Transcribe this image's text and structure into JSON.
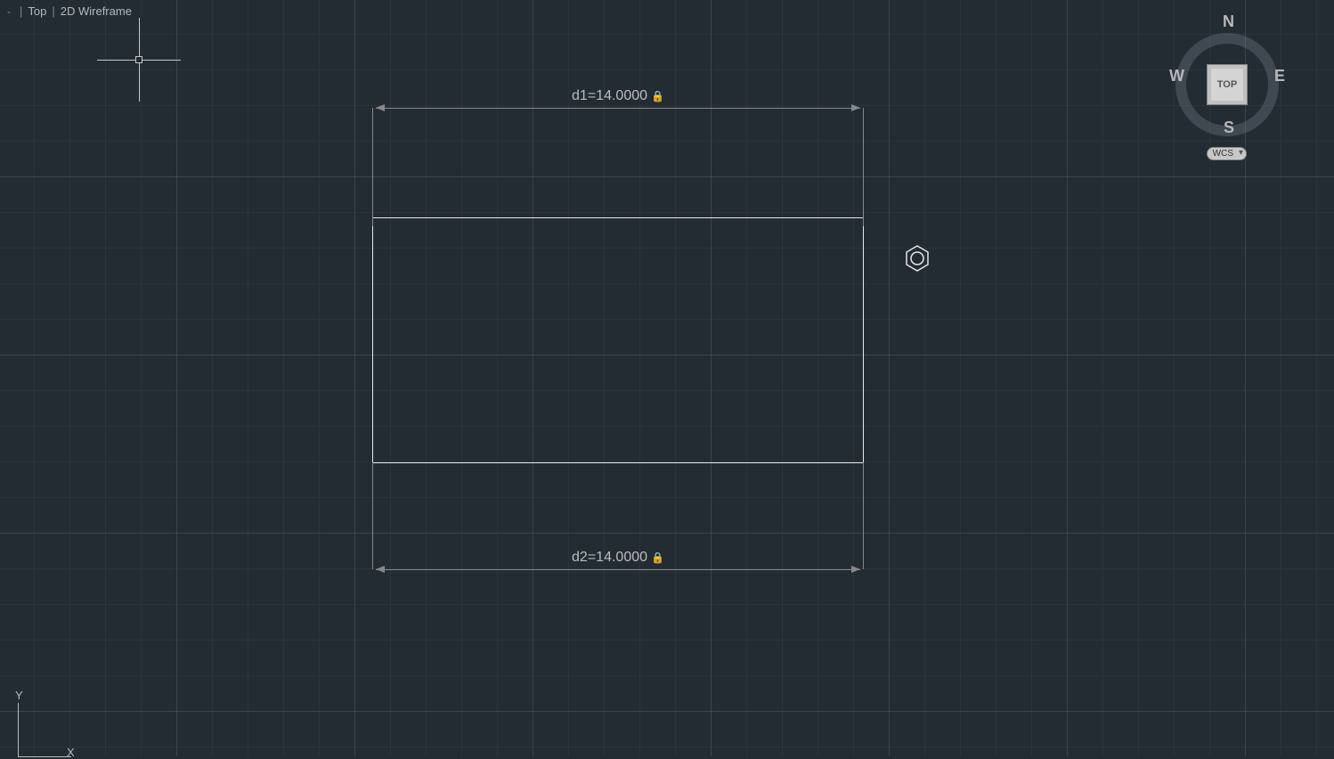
{
  "view_controls": {
    "minimize": "-",
    "orientation": "Top",
    "visual_style": "2D Wireframe"
  },
  "dimensions": {
    "d1": {
      "label": "d1=14.0000",
      "locked": true
    },
    "d2": {
      "label": "d2=14.0000",
      "locked": true
    }
  },
  "ucs": {
    "y": "Y",
    "x": "X"
  },
  "viewcube": {
    "face": "TOP",
    "n": "N",
    "s": "S",
    "e": "E",
    "w": "W"
  },
  "wcs": {
    "label": "WCS"
  }
}
